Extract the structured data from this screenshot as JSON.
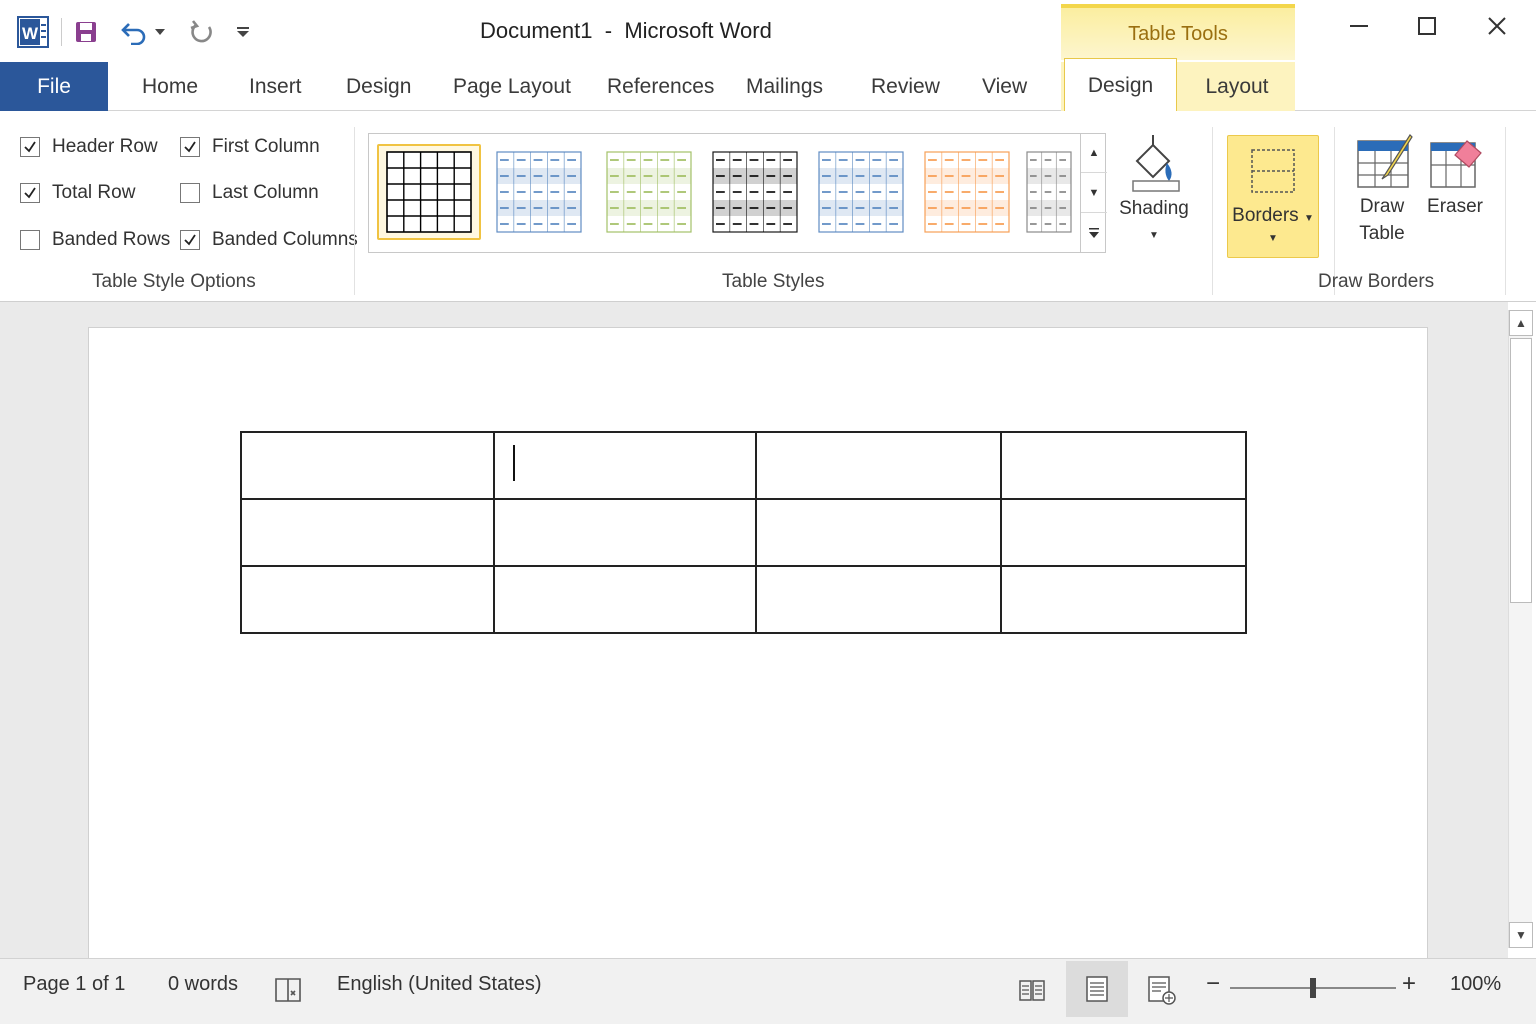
{
  "titlebar": {
    "document_name": "Document1",
    "separator": "-",
    "app_name": "Microsoft Word",
    "context_header": "Table Tools"
  },
  "tabs": {
    "file": "File",
    "items": [
      "Home",
      "Insert",
      "Design",
      "Page Layout",
      "References",
      "Mailings",
      "Review",
      "View"
    ],
    "context": {
      "design": "Design",
      "layout": "Layout",
      "active": "Design"
    }
  },
  "ribbon": {
    "style_options": {
      "label": "Table Style Options",
      "items": [
        {
          "label": "Header Row",
          "checked": true
        },
        {
          "label": "First Column",
          "checked": true
        },
        {
          "label": "Total Row",
          "checked": true
        },
        {
          "label": "Last Column",
          "checked": false
        },
        {
          "label": "Banded Rows",
          "checked": false
        },
        {
          "label": "Banded Columns",
          "checked": true
        }
      ]
    },
    "table_styles": {
      "label": "Table Styles",
      "swatch_colors": [
        "#000000",
        "#4f81bd",
        "#9bbb59",
        "#000000",
        "#4f81bd",
        "#f79646",
        "#7f7f7f"
      ],
      "selected_index": 0,
      "shading_label": "Shading"
    },
    "draw_borders": {
      "label": "Draw Borders",
      "borders_label": "Borders",
      "draw_table_line1": "Draw",
      "draw_table_line2": "Table",
      "eraser_label": "Eraser"
    }
  },
  "document": {
    "table": {
      "rows": 3,
      "cols": 4,
      "caret_cell": [
        0,
        1
      ]
    }
  },
  "statusbar": {
    "page": "Page 1",
    "of": "of 1",
    "words": "0 words",
    "language": "English (United States)",
    "zoom": "100%",
    "zoom_minus": "−",
    "zoom_plus": "+",
    "zoom_level": 0.5
  },
  "colors": {
    "file_tab": "#2b579a",
    "context_accent": "#f3d64b",
    "word_blue": "#2b579a"
  }
}
